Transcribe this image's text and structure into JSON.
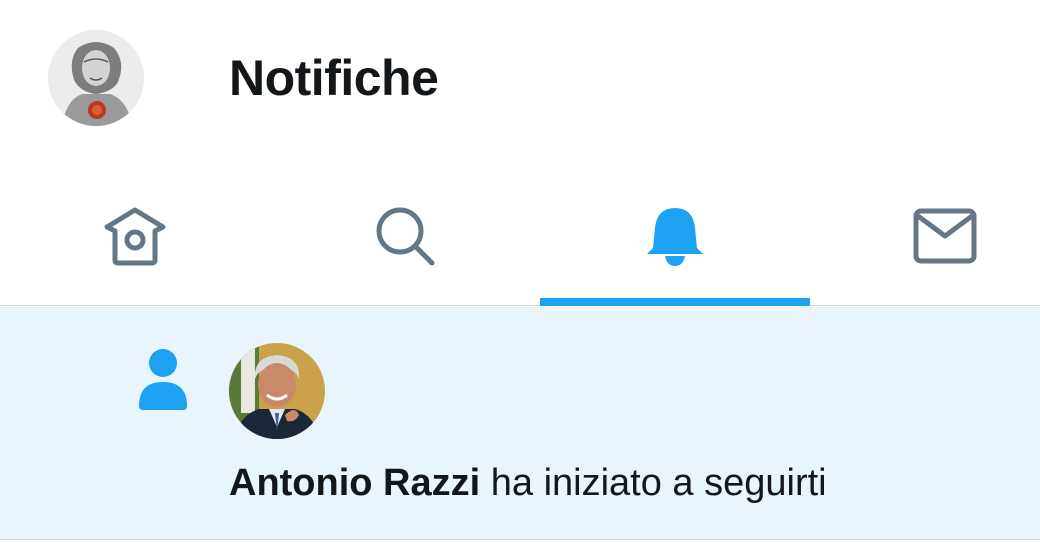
{
  "header": {
    "title": "Notifiche",
    "avatar_icon": "engraved-portrait-avatar"
  },
  "tabs": [
    {
      "name": "home",
      "icon": "home-icon",
      "active": false
    },
    {
      "name": "search",
      "icon": "search-icon",
      "active": false
    },
    {
      "name": "notifications",
      "icon": "bell-icon",
      "active": true
    },
    {
      "name": "messages",
      "icon": "envelope-icon",
      "active": false
    }
  ],
  "notification": {
    "type_icon": "person-follow-icon",
    "user_name": "Antonio Razzi",
    "action_text": " ha iniziato a seguirti"
  },
  "colors": {
    "accent": "#1da1f2",
    "inactive_icon": "#657786",
    "unread_background": "#e8f5fd",
    "text": "#14171a"
  }
}
